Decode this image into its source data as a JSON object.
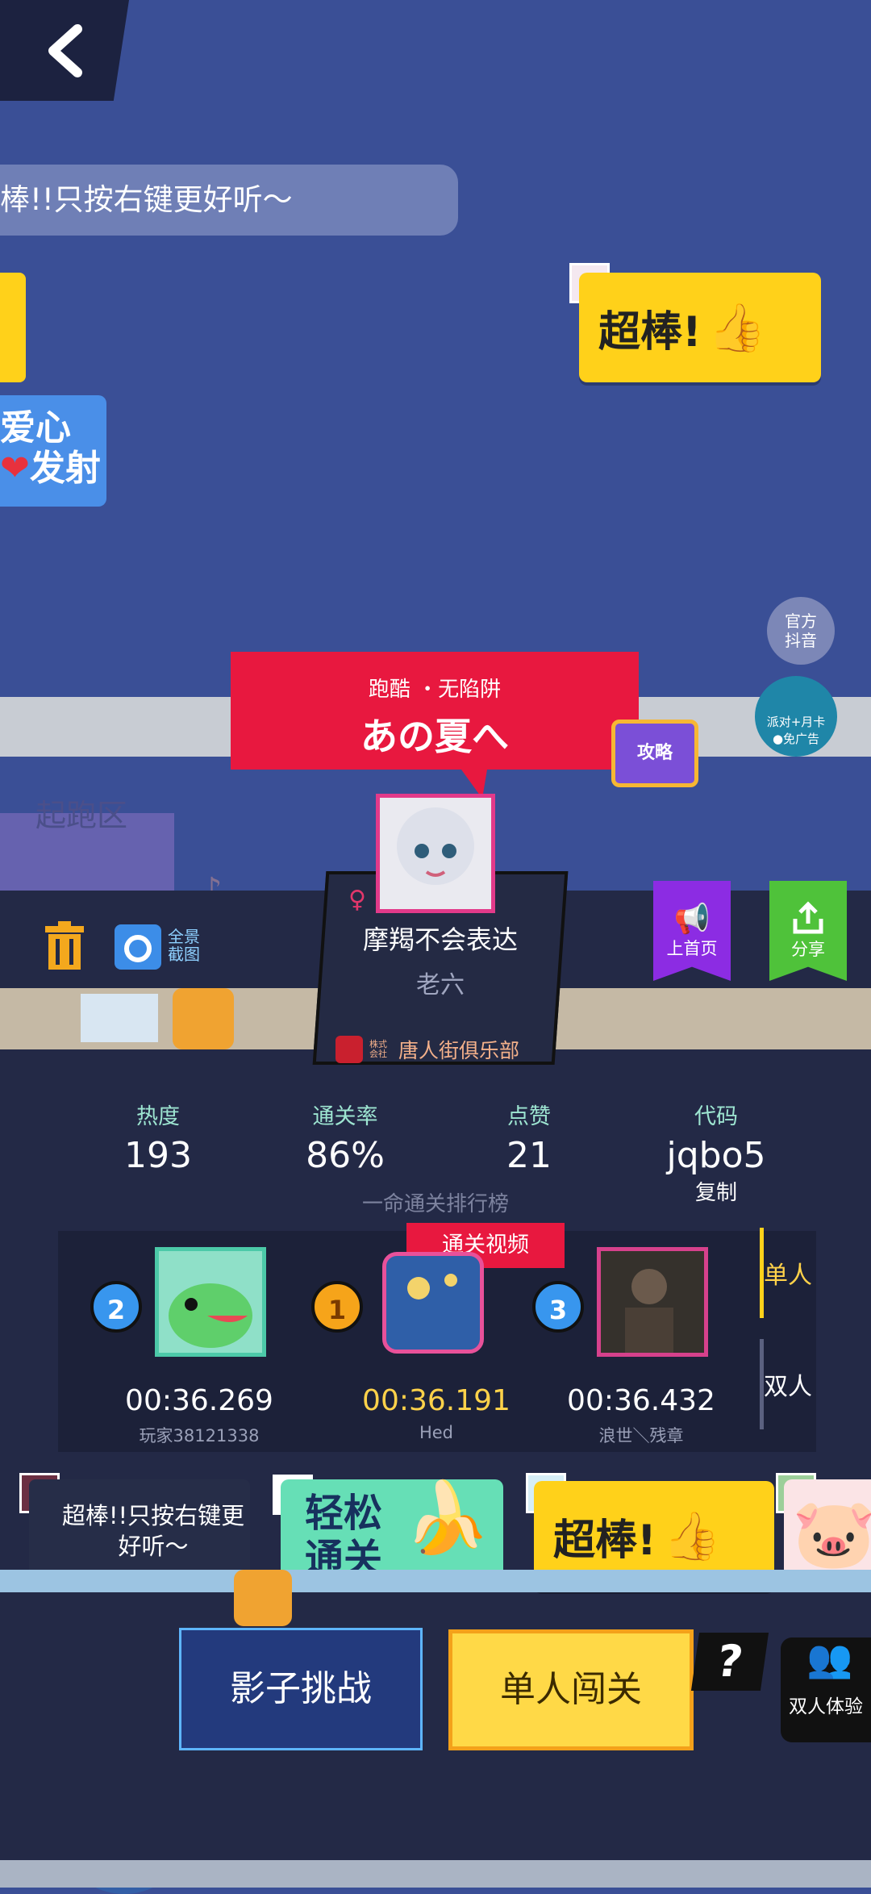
{
  "danmaku": {
    "text": "棒!!只按右键更好听～"
  },
  "love_card": {
    "line1": "爱心",
    "line2": "发射",
    "heart": "❤"
  },
  "stickers": {
    "super": "超棒!",
    "easy": "轻松\n通关",
    "super2": "超棒!"
  },
  "official": {
    "line1": "官方",
    "line2": "抖音"
  },
  "gift": {
    "label": "派对+月卡",
    "sub": "●免广告"
  },
  "level": {
    "subtitle": "跑酷 ・无陷阱",
    "title": "あの夏へ"
  },
  "tv_label": "攻略",
  "start_zone": "起跑区",
  "toolbar": {
    "full_shot": "全景截图"
  },
  "author": {
    "gender_icon": "♀",
    "nickname": "摩羯不会表达",
    "subname": "老六",
    "club": "唐人街俱乐部",
    "club_prefix": "株式会社"
  },
  "actions": {
    "home": "上首页",
    "share": "分享"
  },
  "stats": [
    {
      "label": "热度",
      "value": "193"
    },
    {
      "label": "通关率",
      "value": "86%"
    },
    {
      "label": "点赞",
      "value": "21"
    },
    {
      "label": "代码",
      "value": "jqbo5"
    }
  ],
  "copy_label": "复制",
  "rank_title": "一命通关排行榜",
  "video_badge": "通关视频",
  "leaderboard": [
    {
      "rank": "2",
      "time": "00:36.269",
      "name": "玩家38121338"
    },
    {
      "rank": "1",
      "time": "00:36.191",
      "name": "Hed"
    },
    {
      "rank": "3",
      "time": "00:36.432",
      "name": "浪世＼残章"
    }
  ],
  "tabs": {
    "single": "单人",
    "double": "双人"
  },
  "dm_chip": "超棒!!只按右键更好听～",
  "buttons": {
    "shadow": "影子挑战",
    "single": "单人闯关",
    "help": "?",
    "duo": "双人体验"
  },
  "colors": {
    "bg": "#3a4f96",
    "panel": "#232946",
    "red": "#e8183f",
    "yellow": "#ffd11a",
    "purple": "#8c2ce3",
    "green": "#4fc23a"
  }
}
